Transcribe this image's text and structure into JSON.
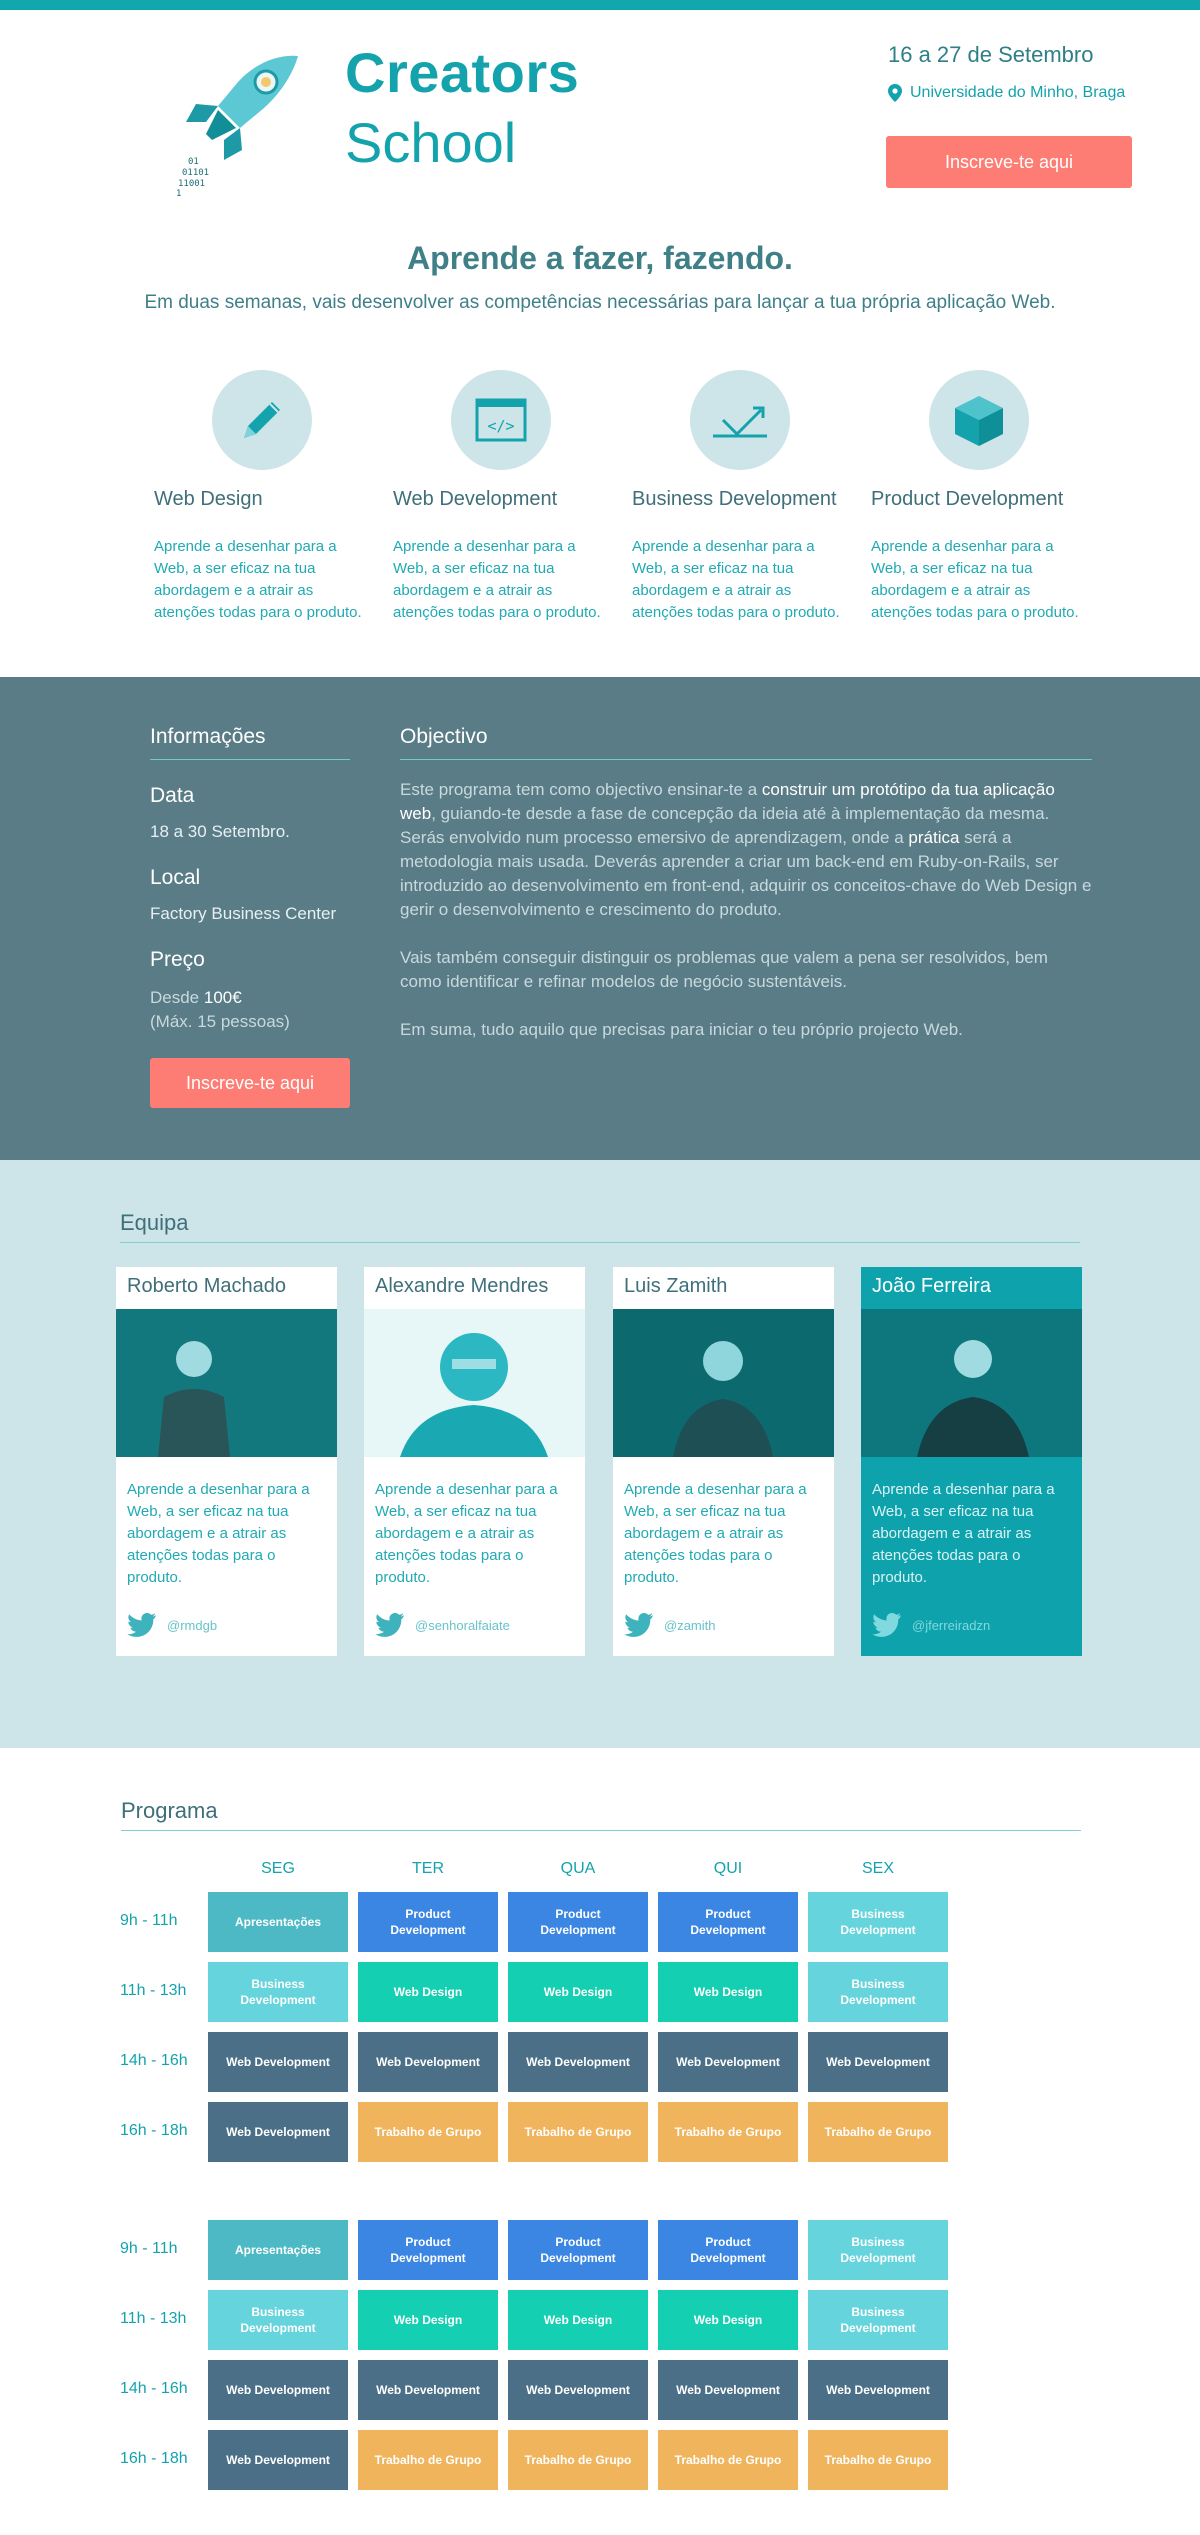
{
  "header": {
    "brand_line1": "Creators",
    "brand_line2": "School",
    "dates": "16 a 27 de Setembro",
    "location": "Universidade do Minho, Braga",
    "cta": "Inscreve-te aqui",
    "logo_binary": [
      "01",
      "01101",
      "11001",
      "1"
    ]
  },
  "intro": {
    "title": "Aprende a fazer, fazendo.",
    "subtitle": "Em duas semanas, vais desenvolver as competências necessárias para lançar a tua própria aplicação Web."
  },
  "features": [
    {
      "title": "Web Design",
      "icon": "pencil-icon",
      "desc": "Aprende a desenhar para a Web, a ser eficaz na tua abordagem e a atrair as atenções todas para o produto."
    },
    {
      "title": "Web Development",
      "icon": "code-window-icon",
      "desc": "Aprende a desenhar para a Web, a ser eficaz na tua abordagem e a atrair as atenções todas para o produto."
    },
    {
      "title": "Business Development",
      "icon": "growth-arrow-icon",
      "desc": "Aprende a desenhar para a Web, a ser eficaz na tua abordagem e a atrair as atenções todas para o produto."
    },
    {
      "title": "Product Development",
      "icon": "box-icon",
      "desc": "Aprende a desenhar para a Web, a ser eficaz na tua abordagem e a atrair as atenções todas para o produto."
    }
  ],
  "info": {
    "heading": "Informações",
    "data_label": "Data",
    "data_value": "18 a 30 Setembro.",
    "local_label": "Local",
    "local_value": "Factory Business Center",
    "preco_label": "Preço",
    "preco_prefix": "Desde ",
    "preco_value": "100€",
    "preco_note": "(Máx. 15 pessoas)",
    "cta": "Inscreve-te aqui"
  },
  "objective": {
    "heading": "Objectivo",
    "p1_a": "Este programa tem como objectivo ensinar-te a ",
    "p1_b": "construir um protótipo da tua aplicação web",
    "p1_c": ", guiando-te desde a fase de concepção da ideia até à implementação da mesma. Serás envolvido num processo emersivo de aprendizagem, onde a ",
    "p1_d": "prática",
    "p1_e": " será a metodologia mais usada. Deverás aprender a criar um back-end em Ruby-on-Rails, ser introduzido ao desenvolvimento em front-end, adquirir os conceitos-chave do Web Design e gerir o desenvolvimento e crescimento do produto.",
    "p2": "Vais também conseguir distinguir os problemas que valem a pena ser resolvidos, bem como identificar e refinar modelos de negócio sustentáveis.",
    "p3": "Em suma, tudo aquilo que precisas para iniciar o teu próprio projecto Web."
  },
  "team": {
    "heading": "Equipa",
    "members": [
      {
        "name": "Roberto Machado",
        "desc": "Aprende a desenhar para a Web, a ser eficaz na tua abordagem e a atrair as atenções todas para o produto.",
        "twitter": "@rmdgb"
      },
      {
        "name": "Alexandre Mendres",
        "desc": "Aprende a desenhar para a Web, a ser eficaz na tua abordagem e a atrair as atenções todas para o produto.",
        "twitter": "@senhoralfaiate"
      },
      {
        "name": "Luis Zamith",
        "desc": "Aprende a desenhar para a Web, a ser eficaz na tua abordagem e a atrair as atenções todas para o produto.",
        "twitter": "@zamith"
      },
      {
        "name": "João Ferreira",
        "desc": "Aprende a desenhar para a Web, a ser eficaz na tua abordagem e a atrair as atenções todas para o produto.",
        "twitter": "@jferreiradzn"
      }
    ]
  },
  "programme": {
    "heading": "Programa",
    "days": [
      "SEG",
      "TER",
      "QUA",
      "QUI",
      "SEX"
    ],
    "times": [
      "9h - 11h",
      "11h - 13h",
      "14h - 16h",
      "16h - 18h"
    ],
    "weeks": [
      [
        [
          {
            "label": "Apresentações",
            "kind": "apr"
          },
          {
            "label": "Product Development",
            "kind": "pd"
          },
          {
            "label": "Product Development",
            "kind": "pd"
          },
          {
            "label": "Product Development",
            "kind": "pd"
          },
          {
            "label": "Business Development",
            "kind": "bd"
          }
        ],
        [
          {
            "label": "Business Development",
            "kind": "bd"
          },
          {
            "label": "Web Design",
            "kind": "wd"
          },
          {
            "label": "Web Design",
            "kind": "wd"
          },
          {
            "label": "Web Design",
            "kind": "wd"
          },
          {
            "label": "Business Development",
            "kind": "bd"
          }
        ],
        [
          {
            "label": "Web Development",
            "kind": "dev"
          },
          {
            "label": "Web Development",
            "kind": "dev"
          },
          {
            "label": "Web Development",
            "kind": "dev"
          },
          {
            "label": "Web Development",
            "kind": "dev"
          },
          {
            "label": "Web Development",
            "kind": "dev"
          }
        ],
        [
          {
            "label": "Web Development",
            "kind": "dev"
          },
          {
            "label": "Trabalho de Grupo",
            "kind": "tg"
          },
          {
            "label": "Trabalho de Grupo",
            "kind": "tg"
          },
          {
            "label": "Trabalho de Grupo",
            "kind": "tg"
          },
          {
            "label": "Trabalho de Grupo",
            "kind": "tg"
          }
        ]
      ],
      [
        [
          {
            "label": "Apresentações",
            "kind": "apr"
          },
          {
            "label": "Product Development",
            "kind": "pd"
          },
          {
            "label": "Product Development",
            "kind": "pd"
          },
          {
            "label": "Product Development",
            "kind": "pd"
          },
          {
            "label": "Business Development",
            "kind": "bd"
          }
        ],
        [
          {
            "label": "Business Development",
            "kind": "bd"
          },
          {
            "label": "Web Design",
            "kind": "wd"
          },
          {
            "label": "Web Design",
            "kind": "wd"
          },
          {
            "label": "Web Design",
            "kind": "wd"
          },
          {
            "label": "Business Development",
            "kind": "bd"
          }
        ],
        [
          {
            "label": "Web Development",
            "kind": "dev"
          },
          {
            "label": "Web Development",
            "kind": "dev"
          },
          {
            "label": "Web Development",
            "kind": "dev"
          },
          {
            "label": "Web Development",
            "kind": "dev"
          },
          {
            "label": "Web Development",
            "kind": "dev"
          }
        ],
        [
          {
            "label": "Web Development",
            "kind": "dev"
          },
          {
            "label": "Trabalho de Grupo",
            "kind": "tg"
          },
          {
            "label": "Trabalho de Grupo",
            "kind": "tg"
          },
          {
            "label": "Trabalho de Grupo",
            "kind": "tg"
          },
          {
            "label": "Trabalho de Grupo",
            "kind": "tg"
          }
        ]
      ]
    ]
  },
  "colors": {
    "accent": "#14a3ad",
    "cta": "#fd7c74",
    "info_bg": "#5a7c87",
    "team_bg": "#cde5e8"
  }
}
